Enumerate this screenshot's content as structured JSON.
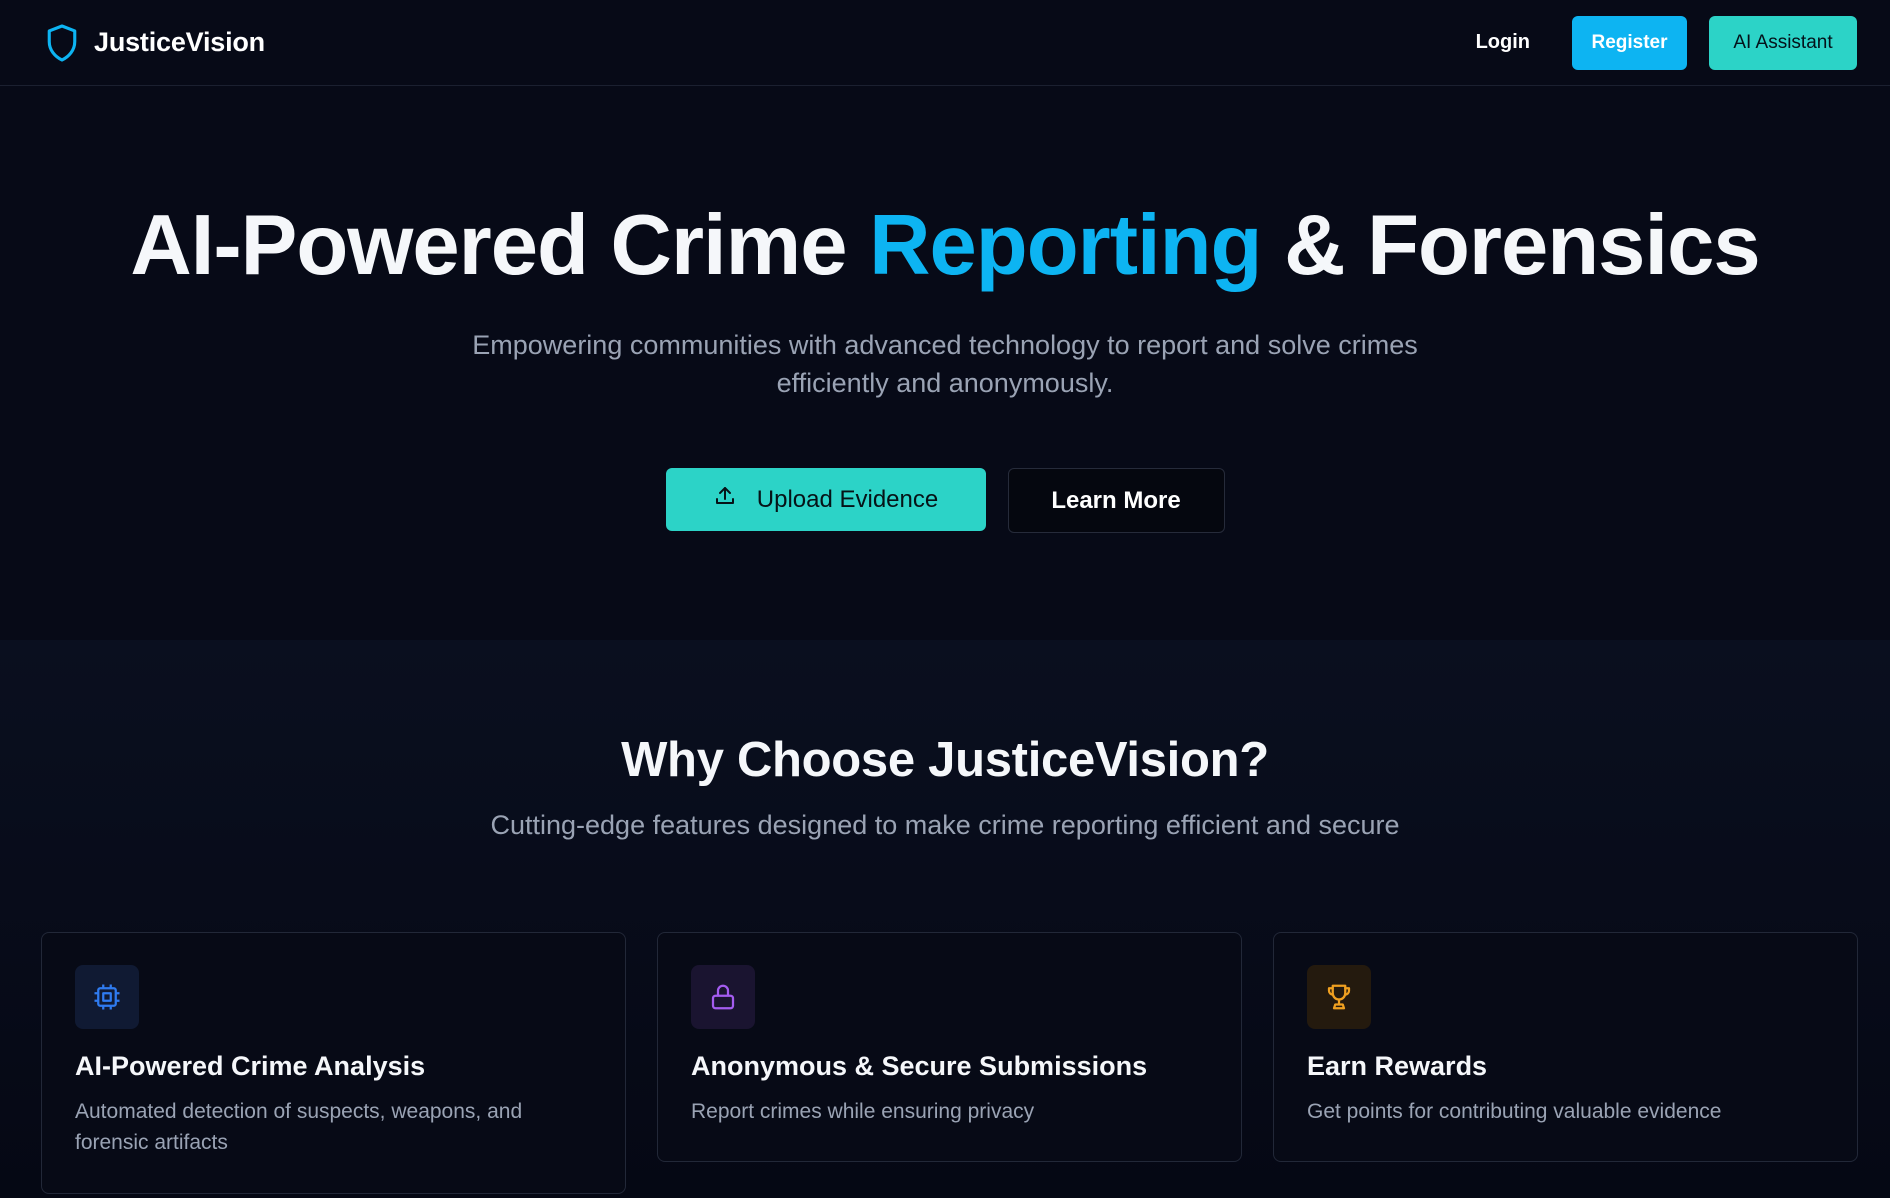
{
  "header": {
    "brand": "JusticeVision",
    "login_label": "Login",
    "register_label": "Register",
    "ai_assistant_label": "AI Assistant"
  },
  "hero": {
    "title_part1": "AI-Powered Crime ",
    "title_accent": "Reporting",
    "title_part2": " & Forensics",
    "subtitle": "Empowering communities with advanced technology to report and solve crimes efficiently and anonymously.",
    "upload_label": "Upload Evidence",
    "learn_more_label": "Learn More"
  },
  "features": {
    "title": "Why Choose JusticeVision?",
    "subtitle": "Cutting-edge features designed to make crime reporting efficient and secure",
    "cards": [
      {
        "icon": "cpu-icon",
        "title": "AI-Powered Crime Analysis",
        "description": "Automated detection of suspects, weapons, and forensic artifacts"
      },
      {
        "icon": "lock-icon",
        "title": "Anonymous & Secure Submissions",
        "description": "Report crimes while ensuring privacy"
      },
      {
        "icon": "trophy-icon",
        "title": "Earn Rewards",
        "description": "Get points for contributing valuable evidence"
      }
    ]
  },
  "colors": {
    "background": "#070a17",
    "accent_blue": "#0db4f2",
    "accent_teal": "#2cd3c7",
    "muted_text": "#9aa3b4"
  }
}
